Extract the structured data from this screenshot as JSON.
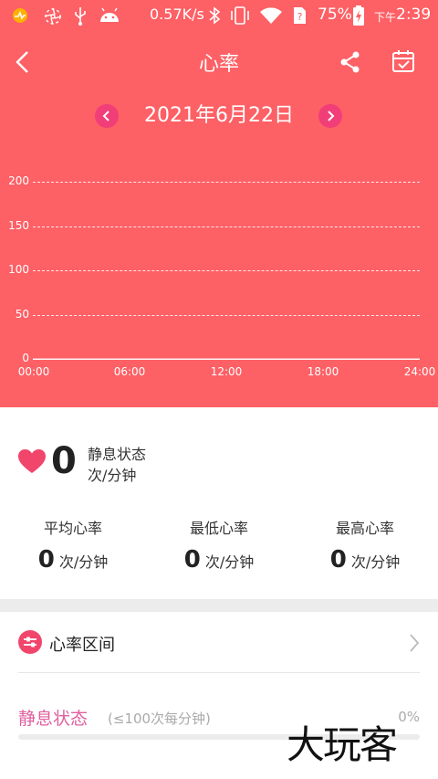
{
  "status_bar": {
    "speed": "0.57K/s",
    "battery": "75%",
    "time_prefix": "下午",
    "time": "2:39",
    "icons": [
      "app-notification-icon",
      "pinwheel-icon",
      "usb-icon",
      "android-icon",
      "bluetooth-icon",
      "vibrate-icon",
      "wifi-icon",
      "sim-unknown-icon",
      "battery-charging-icon"
    ]
  },
  "header": {
    "title": "心率",
    "back_icon": "chevron-left-icon",
    "share_icon": "share-icon",
    "calendar_icon": "calendar-check-icon"
  },
  "date_nav": {
    "date": "2021年6月22日",
    "prev_icon": "chevron-left-icon",
    "next_icon": "chevron-right-icon"
  },
  "colors": {
    "header_bg": "#fd6065",
    "accent": "#f23e78",
    "heart": "#f2456b",
    "resting": "#e0609f"
  },
  "chart_data": {
    "type": "line",
    "x_ticks": [
      "00:00",
      "06:00",
      "12:00",
      "18:00",
      "24:00"
    ],
    "y_ticks": [
      "200",
      "150",
      "100",
      "50",
      "0"
    ],
    "ylim": [
      0,
      200
    ],
    "grid": true,
    "series": [
      {
        "values": [
          0,
          0,
          0,
          0,
          0
        ]
      }
    ]
  },
  "current": {
    "value": "0",
    "state": "静息状态",
    "unit": "次/分钟",
    "heart_icon": "heart-icon"
  },
  "stats": [
    {
      "label": "平均心率",
      "value": "0",
      "unit": "次/分钟"
    },
    {
      "label": "最低心率",
      "value": "0",
      "unit": "次/分钟"
    },
    {
      "label": "最高心率",
      "value": "0",
      "unit": "次/分钟"
    }
  ],
  "zones": {
    "title": "心率区间",
    "icon": "sliders-icon",
    "chevron_icon": "chevron-right-icon",
    "items": [
      {
        "name": "静息状态",
        "range": "(≤100次每分钟)",
        "percent": "0%",
        "progress": 0
      }
    ]
  },
  "watermark": "大玩客"
}
